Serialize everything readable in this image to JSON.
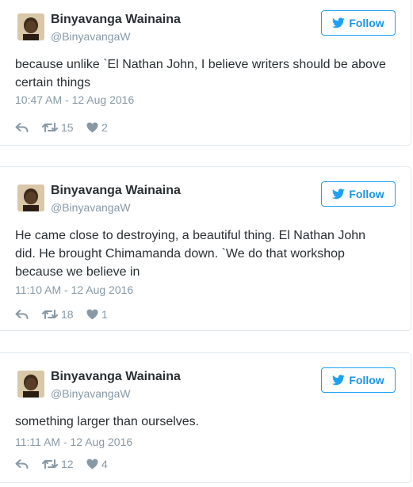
{
  "tweets": [
    {
      "author_name": "Binyavanga Wainaina",
      "author_handle": "@BinyavangaW",
      "follow_label": "Follow",
      "text": "because unlike `El Nathan John, I believe writers should be above certain things",
      "time": "10:47 AM - 12 Aug 2016",
      "retweets": "15",
      "likes": "2"
    },
    {
      "author_name": "Binyavanga Wainaina",
      "author_handle": "@BinyavangaW",
      "follow_label": "Follow",
      "text": "He came close to destroying, a beautiful thing. El Nathan John did. He brought Chimamanda down. `We do that workshop because we believe in",
      "time": "11:10 AM - 12 Aug 2016",
      "retweets": "18",
      "likes": "1"
    },
    {
      "author_name": "Binyavanga Wainaina",
      "author_handle": "@BinyavangaW",
      "follow_label": "Follow",
      "text": "something larger than ourselves.",
      "time": "11:11 AM - 12 Aug 2016",
      "retweets": "12",
      "likes": "4"
    }
  ],
  "icons": {
    "follow": "twitter-bird-icon",
    "reply": "reply-icon",
    "retweet": "retweet-icon",
    "like": "heart-icon"
  },
  "colors": {
    "accent": "#1da1f2",
    "text": "#292f33",
    "muted": "#8899a6",
    "border": "#e1e8ed"
  }
}
